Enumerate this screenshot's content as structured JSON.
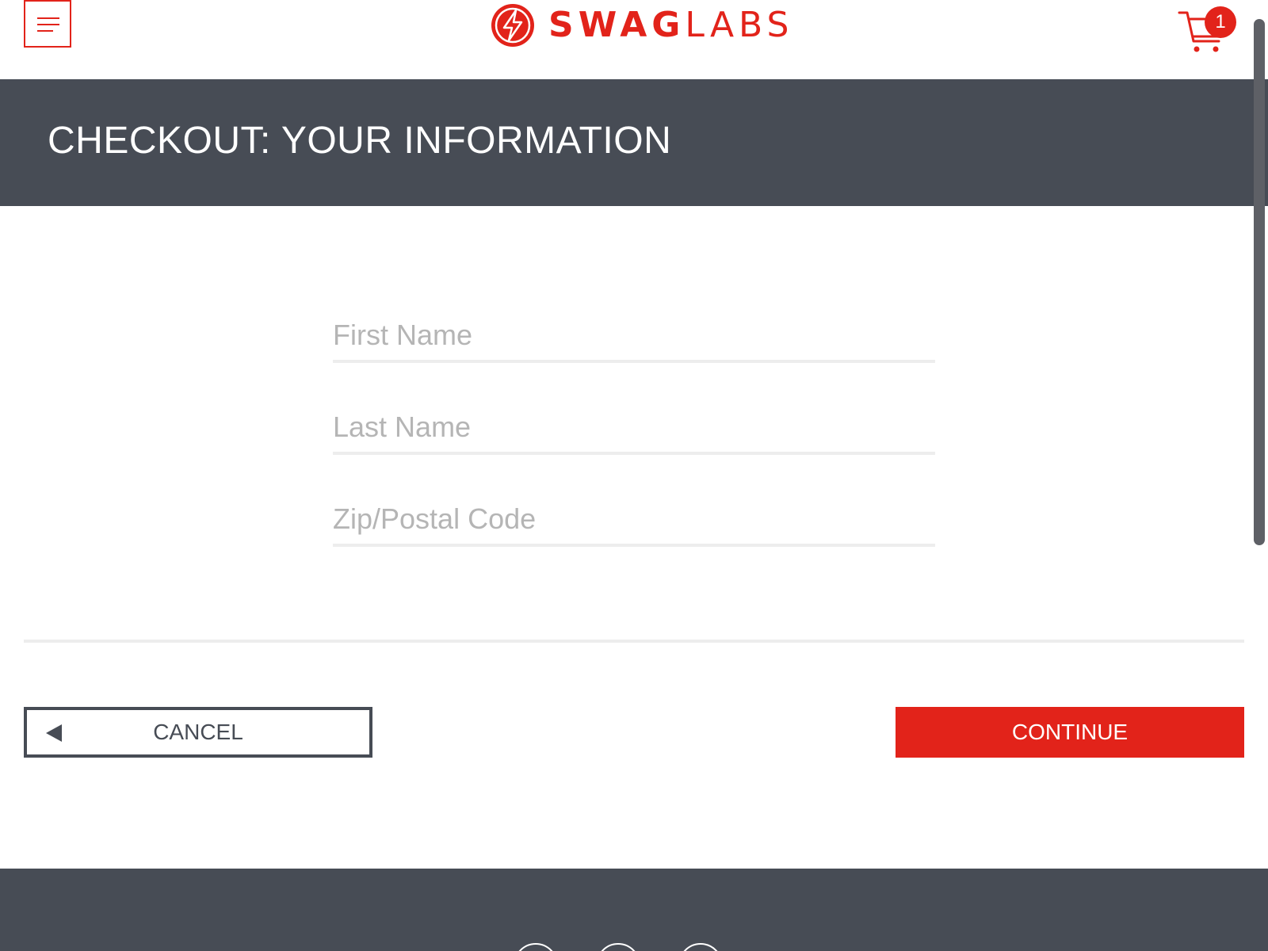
{
  "header": {
    "logo": {
      "part1": "SWAG",
      "part2": "LABS"
    },
    "cart": {
      "badge_count": "1"
    }
  },
  "title": "CHECKOUT: YOUR INFORMATION",
  "form": {
    "first_name": {
      "placeholder": "First Name",
      "value": ""
    },
    "last_name": {
      "placeholder": "Last Name",
      "value": ""
    },
    "postal_code": {
      "placeholder": "Zip/Postal Code",
      "value": ""
    }
  },
  "actions": {
    "cancel_label": "CANCEL",
    "continue_label": "CONTINUE"
  },
  "colors": {
    "brand_red": "#e2231a",
    "dark_gray": "#474c55",
    "field_line": "#ededed",
    "placeholder": "#b5b5b5"
  }
}
